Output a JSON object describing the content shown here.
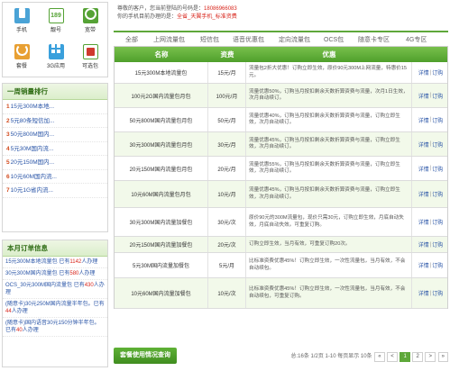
{
  "services": [
    {
      "label": "手机",
      "icon": "phone-icon"
    },
    {
      "label": "靓号",
      "icon": "189-number-icon"
    },
    {
      "label": "宽带",
      "icon": "broadband-icon"
    },
    {
      "label": "套餐",
      "icon": "package-icon"
    },
    {
      "label": "3G应用",
      "icon": "3g-apps-icon"
    },
    {
      "label": "可选包",
      "icon": "optional-package-icon"
    }
  ],
  "ranking": {
    "title": "一周销量排行",
    "items": [
      {
        "num": "1",
        "text": "15元300M本地..."
      },
      {
        "num": "2",
        "text": "5元80条短信加..."
      },
      {
        "num": "3",
        "text": "50元800M国内..."
      },
      {
        "num": "4",
        "text": "5元30M国内流..."
      },
      {
        "num": "5",
        "text": "20元150M国内..."
      },
      {
        "num": "6",
        "text": "10元60M国内流..."
      },
      {
        "num": "7",
        "text": "10元1G省内流..."
      }
    ]
  },
  "orders": {
    "title": "本月订单信息",
    "items": [
      {
        "pre": "15元300M本地流量包 已有",
        "count": "1142",
        "post": "人办理"
      },
      {
        "pre": "30元300M国内流量包 已有",
        "count": "580",
        "post": "人办理"
      },
      {
        "pre": "OCS_30元300M国内流量包 已有",
        "count": "430",
        "post": "人办理"
      },
      {
        "pre": "(随意卡)30元250M国内流量半年包。已有",
        "count": "44",
        "post": "人办理"
      },
      {
        "pre": "(随意卡)国内语音30元150分钟半年包。已有",
        "count": "40",
        "post": "人办理"
      }
    ]
  },
  "notice": {
    "line1_prefix": "尊敬的客户，您当前登陆的号码是：",
    "line1_number": "18086966083",
    "line2_prefix": "你的手机目前办理的是：",
    "line2_value": "全省_天翼手机_标准资费"
  },
  "tabs": [
    {
      "label": "全部",
      "active": false
    },
    {
      "label": "上网流量包",
      "active": false
    },
    {
      "label": "短信包",
      "active": false
    },
    {
      "label": "语音优惠包",
      "active": false
    },
    {
      "label": "定向流量包",
      "active": false
    },
    {
      "label": "OCS包",
      "active": false
    },
    {
      "label": "随意卡专区",
      "active": false
    },
    {
      "label": "4G专区",
      "active": false
    }
  ],
  "table": {
    "headers": {
      "name": "名称",
      "price": "资费",
      "benefit": "优惠"
    },
    "detail_label": "详情",
    "order_label": "订购",
    "rows": [
      {
        "name": "15元300M本地流量包",
        "price": "15元/月",
        "desc": "流量包2折大优惠！订购立即生效，原价90元300M上网流量，特惠价15元。"
      },
      {
        "name": "100元2G国内流量包月包",
        "price": "100元/月",
        "desc": "流量优惠50%，订购当月按扣剩余天数折算资费与流量，次月1日生效，次月自动续订。"
      },
      {
        "name": "50元800M国内流量包月包",
        "price": "50元/月",
        "desc": "流量优惠40%，订购当月按扣剩余天数折算资费与流量，订购立即生效，次月自动续订。"
      },
      {
        "name": "30元300M国内流量包月包",
        "price": "30元/月",
        "desc": "流量优惠45%，订购当月按扣剩余天数折算资费与流量，订购立即生效，次月自动续订。"
      },
      {
        "name": "20元150M国内流量包月包",
        "price": "20元/月",
        "desc": "流量优惠55%，订购当月按扣剩余天数折算资费与流量，订购立即生效，次月自动续订。"
      },
      {
        "name": "10元60M国内流量包月包",
        "price": "10元/月",
        "desc": "流量优惠45%，订购当月按扣剩余天数折算资费与流量，订购立即生效，次月自动续订。"
      },
      {
        "name": "30元300M国内流量加餐包",
        "price": "30元/次",
        "desc": "原价90元的300M流量包，现价只需30元，订购立即生效，月底自动失效，月底自动失效。可重复订购。"
      },
      {
        "name": "20元150M国内流量加餐包",
        "price": "20元/次",
        "desc": "订购立即生效，当月有效，可重复订购20次。"
      },
      {
        "name": "5元30M国内流量加餐包",
        "price": "5元/月",
        "desc": "比标准资费优惠45%！订购立即生效，一次性流量包，当月有效，不会自动续包。"
      },
      {
        "name": "10元60M国内流量加餐包",
        "price": "10元/次",
        "desc": "比标准资费优惠45%！订购立即生效，一次性流量包，当月有效，不会自动续包，可重复订购。"
      }
    ]
  },
  "bottom_button": "套餐使用情况查询",
  "pager": {
    "summary": "总:16条  1/2页 1-10 每页显示 10条",
    "first": "«",
    "prev": "<",
    "pages": [
      "1",
      "2"
    ],
    "current": "1",
    "next": ">",
    "last": "»"
  }
}
